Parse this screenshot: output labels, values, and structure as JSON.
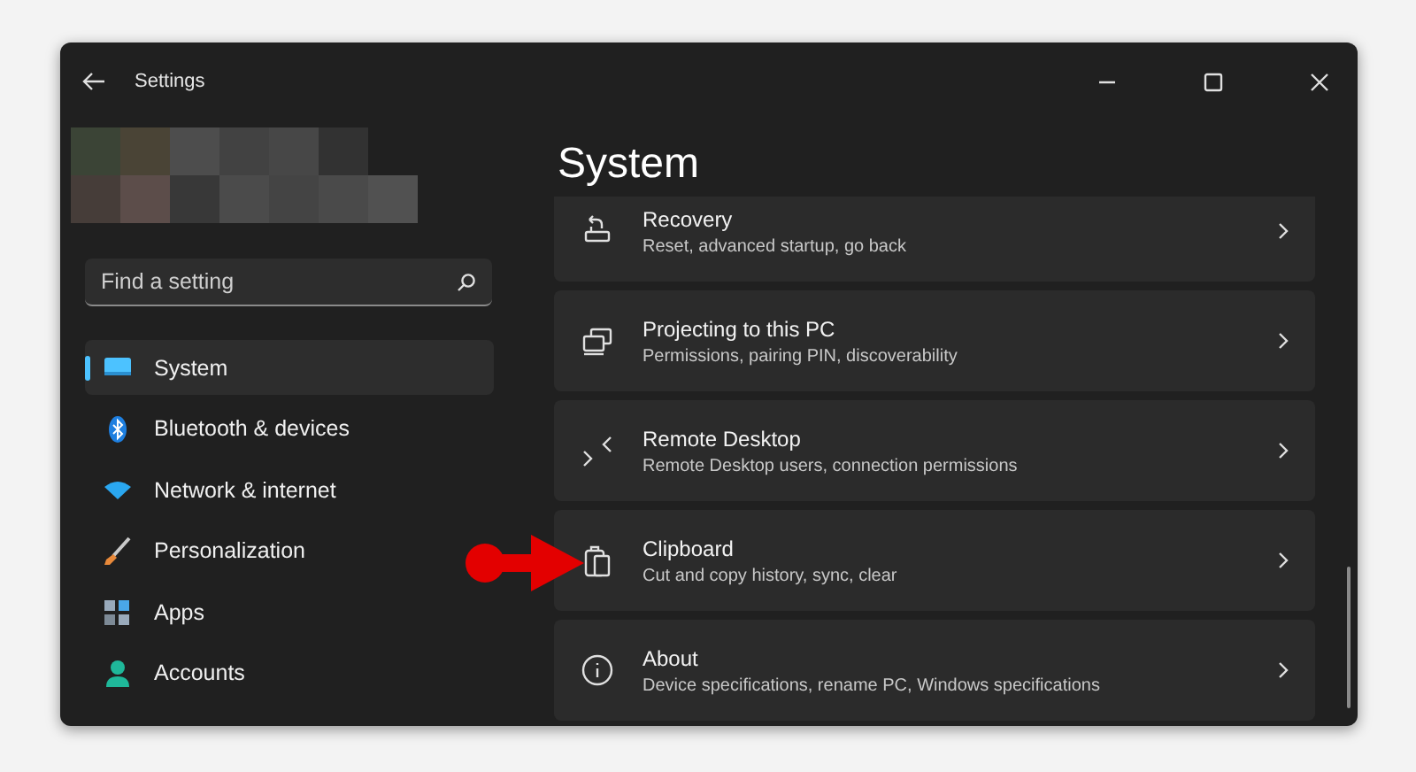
{
  "window": {
    "title": "Settings"
  },
  "search": {
    "placeholder": "Find a setting"
  },
  "sidebar": {
    "items": [
      {
        "label": "System",
        "selected": true
      },
      {
        "label": "Bluetooth & devices",
        "selected": false
      },
      {
        "label": "Network & internet",
        "selected": false
      },
      {
        "label": "Personalization",
        "selected": false
      },
      {
        "label": "Apps",
        "selected": false
      },
      {
        "label": "Accounts",
        "selected": false
      }
    ]
  },
  "page": {
    "title": "System",
    "items": [
      {
        "title": "Recovery",
        "subtitle": "Reset, advanced startup, go back"
      },
      {
        "title": "Projecting to this PC",
        "subtitle": "Permissions, pairing PIN, discoverability"
      },
      {
        "title": "Remote Desktop",
        "subtitle": "Remote Desktop users, connection permissions"
      },
      {
        "title": "Clipboard",
        "subtitle": "Cut and copy history, sync, clear"
      },
      {
        "title": "About",
        "subtitle": "Device specifications, rename PC, Windows specifications"
      }
    ]
  }
}
